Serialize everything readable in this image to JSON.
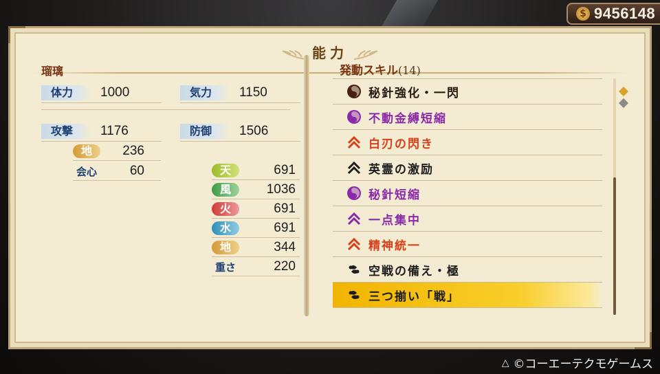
{
  "currency": {
    "icon": "coin-icon",
    "value": "9456148"
  },
  "panel": {
    "title": "能力"
  },
  "character": {
    "name": "瑠璃"
  },
  "stats": {
    "hp": {
      "label": "体力",
      "value": "1000"
    },
    "ki": {
      "label": "気力",
      "value": "1150"
    },
    "attack": {
      "label": "攻撃",
      "value": "1176"
    },
    "defense": {
      "label": "防御",
      "value": "1506"
    },
    "attack_element": {
      "label": "地",
      "value": "236",
      "color": "#d49a3a"
    },
    "critical": {
      "label": "会心",
      "value": "60"
    },
    "resist": [
      {
        "label": "天",
        "value": "691",
        "color": "#9bbb2a"
      },
      {
        "label": "風",
        "value": "1036",
        "color": "#3f9a4a"
      },
      {
        "label": "火",
        "value": "691",
        "color": "#cf3a3a"
      },
      {
        "label": "水",
        "value": "691",
        "color": "#2f8fb8"
      },
      {
        "label": "地",
        "value": "344",
        "color": "#d49a3a"
      }
    ],
    "weight": {
      "label": "重さ",
      "value": "220"
    }
  },
  "skills": {
    "header": "発動スキル",
    "count": "(14)",
    "items": [
      {
        "label": "秘針強化・一閃",
        "icon": "circle-swirl-icon",
        "color": "#2a1a12",
        "iconColor": "#4a1e10"
      },
      {
        "label": "不動金縛短縮",
        "icon": "circle-swirl-icon",
        "color": "#8a2aa8",
        "iconColor": "#8a2aa8"
      },
      {
        "label": "白刃の閃き",
        "icon": "chevron-up-icon",
        "color": "#d8401a",
        "iconColor": "#d8401a"
      },
      {
        "label": "英霊の激励",
        "icon": "chevron-up-icon",
        "color": "#1c1c1c",
        "iconColor": "#1c1c1c"
      },
      {
        "label": "秘針短縮",
        "icon": "circle-swirl-icon",
        "color": "#8a2aa8",
        "iconColor": "#8a2aa8"
      },
      {
        "label": "一点集中",
        "icon": "chevron-up-icon",
        "color": "#8a2aa8",
        "iconColor": "#8a2aa8"
      },
      {
        "label": "精神統一",
        "icon": "chevron-up-icon",
        "color": "#d8401a",
        "iconColor": "#d8401a"
      },
      {
        "label": "空戦の備え・極",
        "icon": "tomoe-icon",
        "color": "#1c1c1c",
        "iconColor": "#1c1c1c"
      },
      {
        "label": "三つ揃い「戦」",
        "icon": "tomoe-icon",
        "color": "#1c1c1c",
        "iconColor": "#1c1c1c",
        "selected": true
      }
    ]
  },
  "footer": {
    "button": "△",
    "copyright": "©コーエーテクモゲームス"
  }
}
